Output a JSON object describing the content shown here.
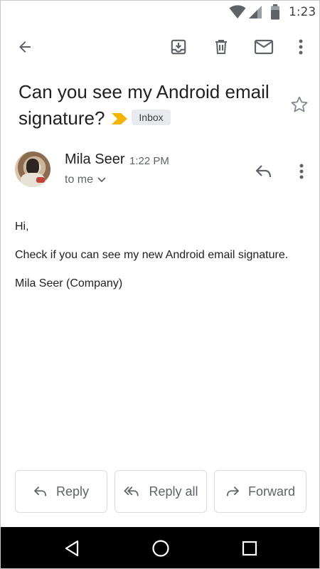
{
  "status_bar": {
    "time": "1:23",
    "icons": [
      "wifi-icon",
      "cell-signal-icon",
      "battery-icon"
    ]
  },
  "toolbar": {
    "icons": [
      "back-arrow-icon",
      "archive-icon",
      "trash-icon",
      "mail-icon",
      "more-vert-icon"
    ]
  },
  "email": {
    "subject": "Can you see my Android email signature?",
    "label": "Inbox",
    "importance_color": "#f4b400",
    "sender": {
      "name": "Mila Seer",
      "time": "1:22 PM",
      "recipient": "to me"
    },
    "body": [
      "Hi,",
      "Check if you can see my new Android email signature.",
      "Mila Seer (Company)"
    ]
  },
  "actions": {
    "reply_label": "Reply",
    "reply_all_label": "Reply all",
    "forward_label": "Forward"
  },
  "nav_bar": {
    "icons": [
      "nav-back-icon",
      "nav-home-icon",
      "nav-recents-icon"
    ]
  }
}
